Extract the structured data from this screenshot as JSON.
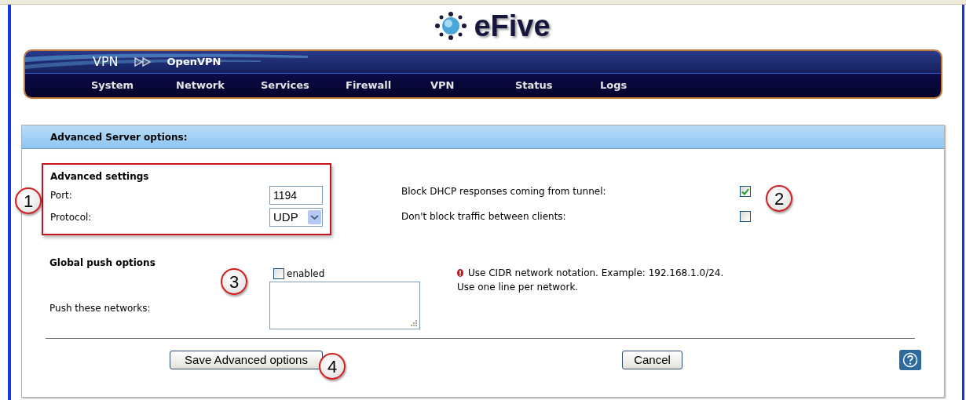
{
  "logo": {
    "text": "eFive"
  },
  "breadcrumb": {
    "section": "VPN",
    "page": "OpenVPN"
  },
  "menu": [
    {
      "label": "System"
    },
    {
      "label": "Network"
    },
    {
      "label": "Services"
    },
    {
      "label": "Firewall"
    },
    {
      "label": "VPN"
    },
    {
      "label": "Status"
    },
    {
      "label": "Logs"
    }
  ],
  "section_title": "Advanced Server options:",
  "advanced_settings": {
    "title": "Advanced settings",
    "port": {
      "label": "Port:",
      "value": "1194"
    },
    "protocol": {
      "label": "Protocol:",
      "value": "UDP"
    }
  },
  "options": [
    {
      "label": "Block DHCP responses coming from tunnel:",
      "checked": true
    },
    {
      "label": "Don't block traffic between clients:",
      "checked": false
    }
  ],
  "global_push": {
    "title": "Global push options",
    "enabled": {
      "label": "enabled",
      "checked": false
    },
    "networks_label": "Push these networks:",
    "note": [
      "Use CIDR network notation. Example: 192.168.1.0/24.",
      "Use one line per network."
    ]
  },
  "buttons": {
    "save": "Save Advanced options",
    "cancel": "Cancel"
  },
  "callouts": [
    "1",
    "2",
    "3",
    "4"
  ]
}
